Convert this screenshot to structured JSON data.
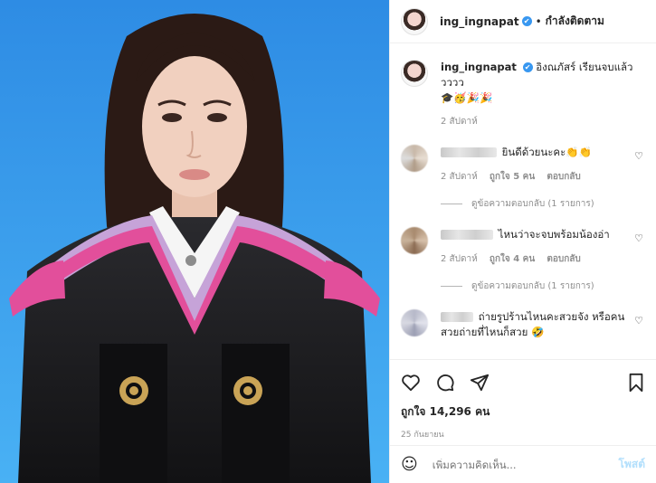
{
  "post_header": {
    "username": "ing_ingnapat",
    "verified_icon": "✔",
    "separator": "•",
    "follow_label": "กำลังติดตาม"
  },
  "caption": {
    "username": "ing_ingnapat",
    "text": "อิงณภัสร์ เรียนจบแล้ววววว",
    "emojis": "🎓🥳🎉🎉",
    "time": "2 สัปดาห์"
  },
  "comments": [
    {
      "text": "ยินดีด้วยนะคะ👏👏",
      "time": "2 สัปดาห์",
      "likes": "ถูกใจ 5 คน",
      "reply_label": "ตอบกลับ",
      "view_replies": "ดูข้อความตอบกลับ (1 รายการ)"
    },
    {
      "text": "ไหนว่าจะจบพร้อมน้องอ่า",
      "time": "2 สัปดาห์",
      "likes": "ถูกใจ 4 คน",
      "reply_label": "ตอบกลับ",
      "view_replies": "ดูข้อความตอบกลับ (1 รายการ)"
    },
    {
      "text": "ถ่ายรูปร้านไหนคะสวยจัง หรือคนสวยถ่ายที่ไหนก็สวย 🤣"
    }
  ],
  "likes_count": "ถูกใจ 14,296 คน",
  "post_date": "25 กันยายน",
  "add_comment": {
    "placeholder": "เพิ่มความคิดเห็น...",
    "post_label": "โพสต์"
  },
  "icons": {
    "like": "heart-icon",
    "comment": "comment-icon",
    "share": "share-icon",
    "save": "bookmark-icon",
    "emoji": "emoji-icon"
  },
  "colors": {
    "verified": "#3897f0",
    "post_disabled": "#b2dffc",
    "muted": "#8e8e8e"
  }
}
